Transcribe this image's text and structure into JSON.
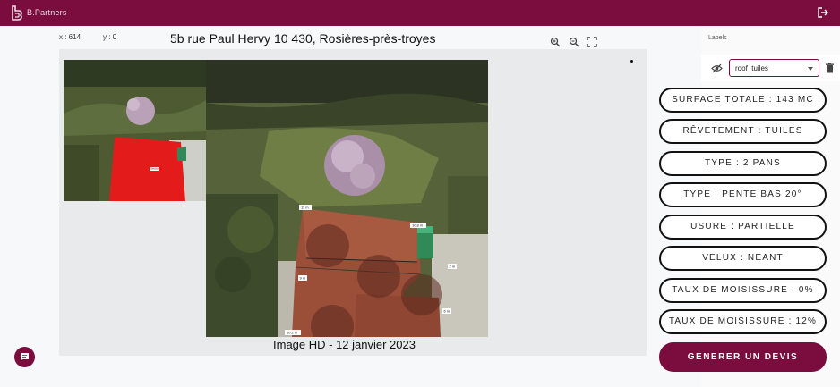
{
  "header": {
    "brand": "B.Partners",
    "logo_icon": "b-partners-logo",
    "logout_icon": "logout-icon"
  },
  "toolbar": {
    "coord_x": "x : 614",
    "coord_y": "y : 0",
    "address": "5b rue Paul Hervy 10 430, Rosières-près-troyes",
    "tools": [
      "zoom-in-icon",
      "zoom-out-icon",
      "fullscreen-icon"
    ]
  },
  "viewer": {
    "caption": "Image HD - 12 janvier 2023",
    "measurements": [
      "11 m",
      "10.8 m",
      "9 m",
      "2 m",
      "10.2 m",
      "6 m"
    ],
    "small_roof_label": "Section 1"
  },
  "labels_panel": {
    "title": "Labels",
    "selected_label": "roof_tuiles",
    "eye_icon": "eye-off-icon",
    "delete_icon": "trash-icon"
  },
  "attributes": [
    "SURFACE TOTALE : 143 MC",
    "RÊVETEMENT : TUILES",
    "TYPE : 2 PANS",
    "TYPE : PENTE BAS 20°",
    "USURE : PARTIELLE",
    "VELUX : NEANT",
    "TAUX DE MOISISSURE : 0%",
    "TAUX DE MOISISSURE : 12%"
  ],
  "cta_label": "GENERER UN DEVIS",
  "colors": {
    "brand": "#7a0c3e",
    "roof_highlight": "#e31b1b"
  }
}
